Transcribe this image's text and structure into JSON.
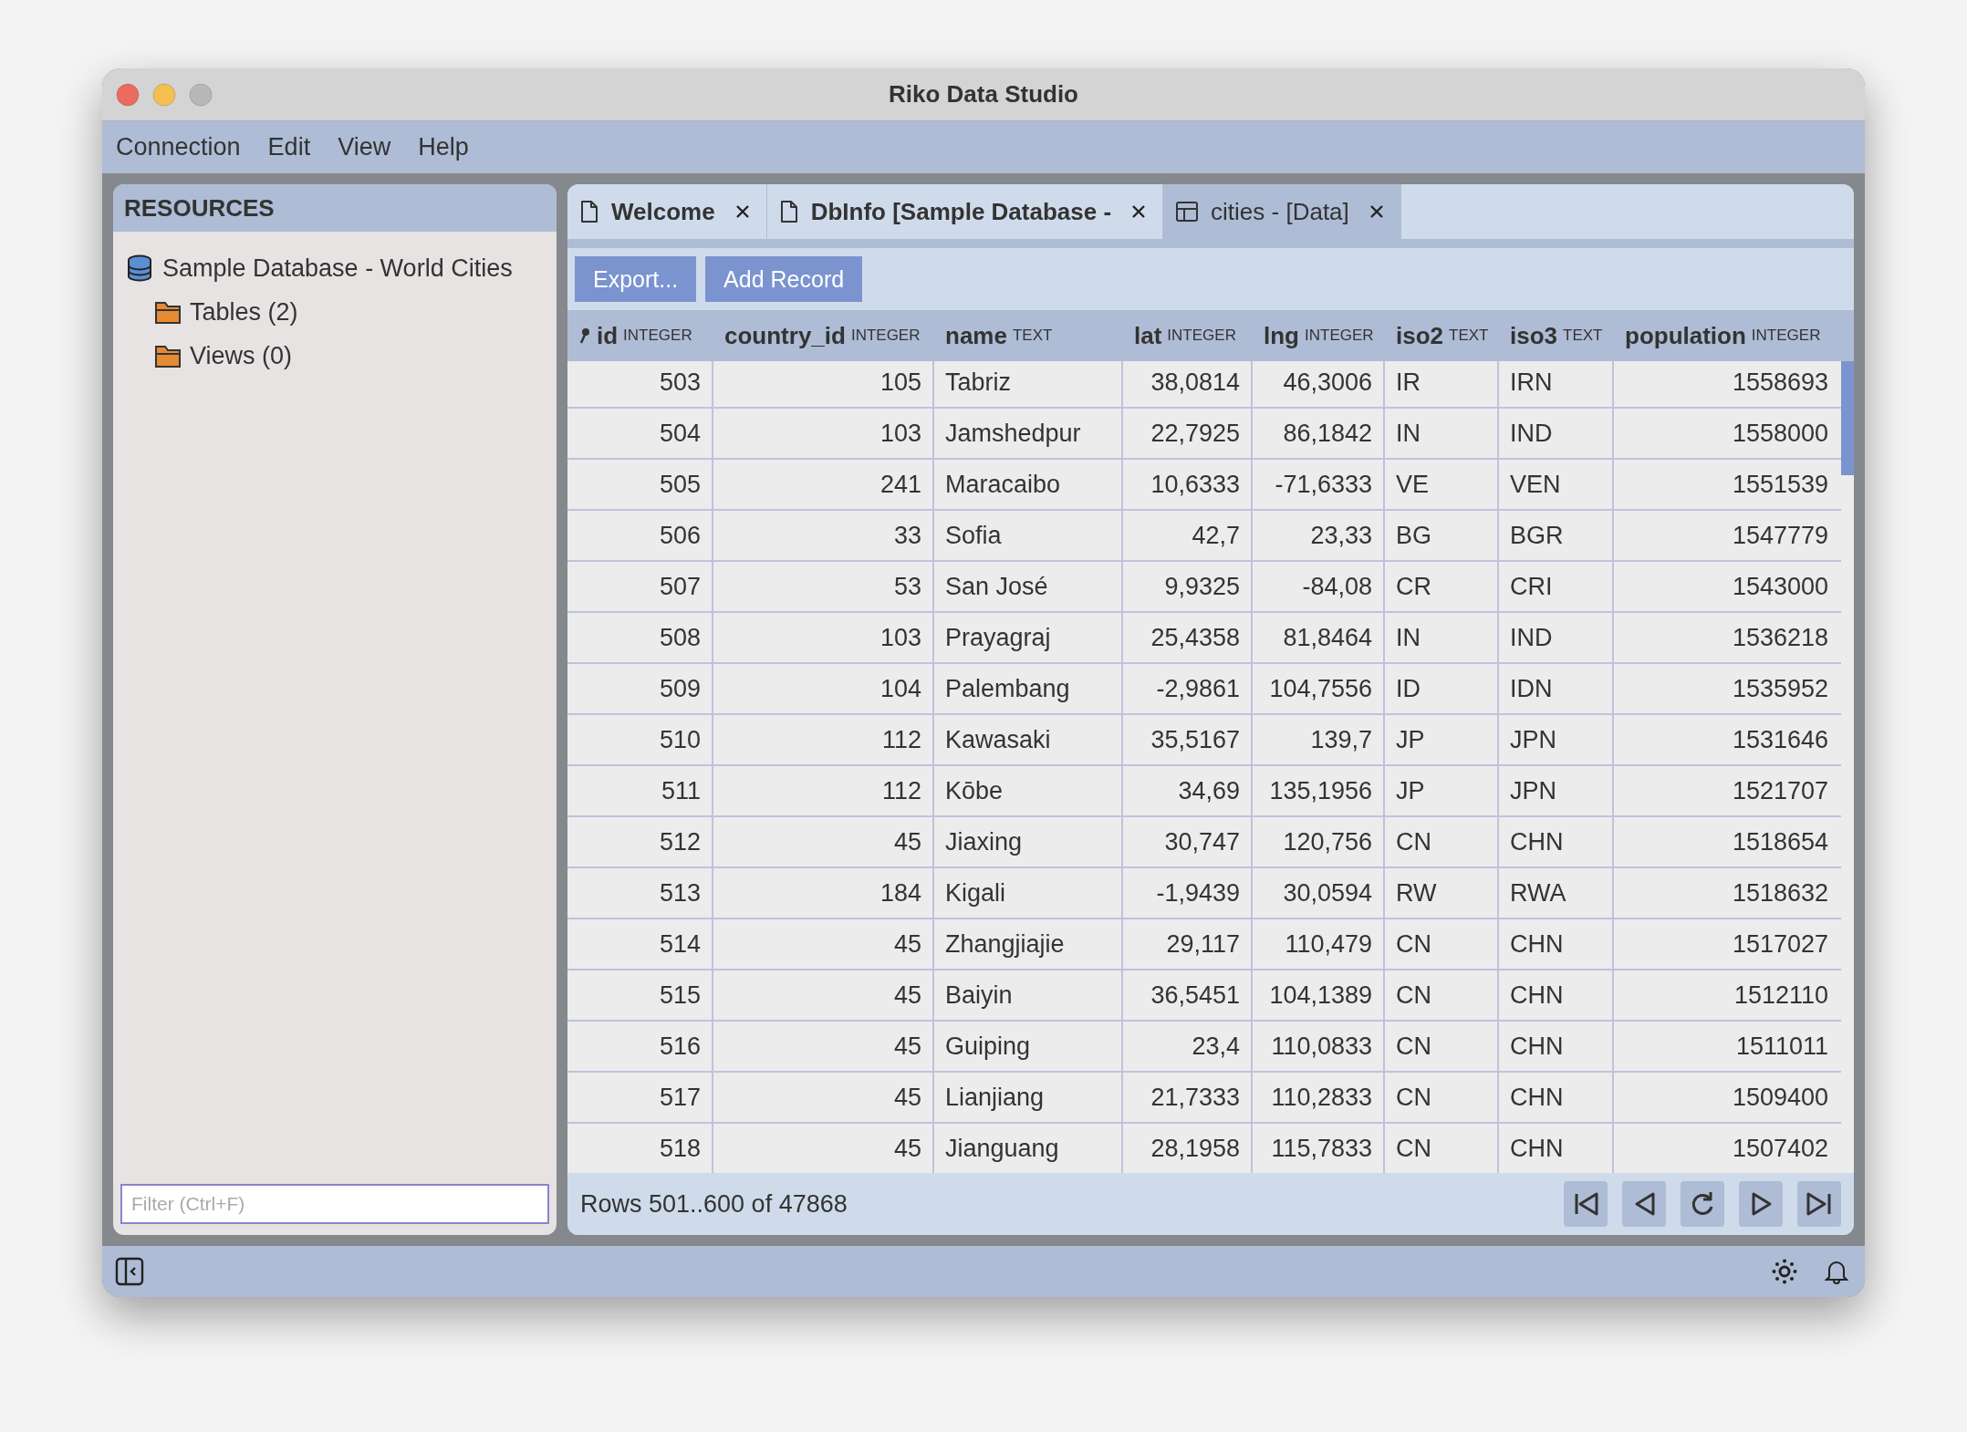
{
  "window": {
    "title": "Riko Data Studio"
  },
  "menu": [
    "Connection",
    "Edit",
    "View",
    "Help"
  ],
  "sidebar": {
    "title": "RESOURCES",
    "tree": [
      {
        "label": "Sample Database - World Cities",
        "kind": "database",
        "children": [
          {
            "label": "Tables (2)",
            "kind": "folder"
          },
          {
            "label": "Views (0)",
            "kind": "folder"
          }
        ]
      }
    ],
    "filter": {
      "placeholder": "Filter (Ctrl+F)"
    }
  },
  "tabs": [
    {
      "label": "Welcome",
      "kind": "document",
      "selected": false
    },
    {
      "label": "DbInfo [Sample Database -",
      "kind": "document",
      "selected": false
    },
    {
      "label": "cities - [Data]",
      "kind": "table",
      "selected": true
    }
  ],
  "toolbar": [
    "Export...",
    "Add Record"
  ],
  "table": {
    "columns": [
      {
        "name": "id",
        "type": "INTEGER",
        "primary_key": true
      },
      {
        "name": "country_id",
        "type": "INTEGER",
        "primary_key": false
      },
      {
        "name": "name",
        "type": "TEXT",
        "primary_key": false
      },
      {
        "name": "lat",
        "type": "INTEGER",
        "primary_key": false
      },
      {
        "name": "lng",
        "type": "INTEGER",
        "primary_key": false
      },
      {
        "name": "iso2",
        "type": "TEXT",
        "primary_key": false
      },
      {
        "name": "iso3",
        "type": "TEXT",
        "primary_key": false
      },
      {
        "name": "population",
        "type": "INTEGER",
        "primary_key": false
      }
    ],
    "rows": [
      [
        "503",
        "105",
        "Tabriz",
        "38,0814",
        "46,3006",
        "IR",
        "IRN",
        "1558693"
      ],
      [
        "504",
        "103",
        "Jamshedpur",
        "22,7925",
        "86,1842",
        "IN",
        "IND",
        "1558000"
      ],
      [
        "505",
        "241",
        "Maracaibo",
        "10,6333",
        "-71,6333",
        "VE",
        "VEN",
        "1551539"
      ],
      [
        "506",
        "33",
        "Sofia",
        "42,7",
        "23,33",
        "BG",
        "BGR",
        "1547779"
      ],
      [
        "507",
        "53",
        "San José",
        "9,9325",
        "-84,08",
        "CR",
        "CRI",
        "1543000"
      ],
      [
        "508",
        "103",
        "Prayagraj",
        "25,4358",
        "81,8464",
        "IN",
        "IND",
        "1536218"
      ],
      [
        "509",
        "104",
        "Palembang",
        "-2,9861",
        "104,7556",
        "ID",
        "IDN",
        "1535952"
      ],
      [
        "510",
        "112",
        "Kawasaki",
        "35,5167",
        "139,7",
        "JP",
        "JPN",
        "1531646"
      ],
      [
        "511",
        "112",
        "Kōbe",
        "34,69",
        "135,1956",
        "JP",
        "JPN",
        "1521707"
      ],
      [
        "512",
        "45",
        "Jiaxing",
        "30,747",
        "120,756",
        "CN",
        "CHN",
        "1518654"
      ],
      [
        "513",
        "184",
        "Kigali",
        "-1,9439",
        "30,0594",
        "RW",
        "RWA",
        "1518632"
      ],
      [
        "514",
        "45",
        "Zhangjiajie",
        "29,117",
        "110,479",
        "CN",
        "CHN",
        "1517027"
      ],
      [
        "515",
        "45",
        "Baiyin",
        "36,5451",
        "104,1389",
        "CN",
        "CHN",
        "1512110"
      ],
      [
        "516",
        "45",
        "Guiping",
        "23,4",
        "110,0833",
        "CN",
        "CHN",
        "1511011"
      ],
      [
        "517",
        "45",
        "Lianjiang",
        "21,7333",
        "110,2833",
        "CN",
        "CHN",
        "1509400"
      ],
      [
        "518",
        "45",
        "Jianguang",
        "28,1958",
        "115,7833",
        "CN",
        "CHN",
        "1507402"
      ]
    ]
  },
  "footer": {
    "summary": "Rows 501..600 of 47868"
  }
}
